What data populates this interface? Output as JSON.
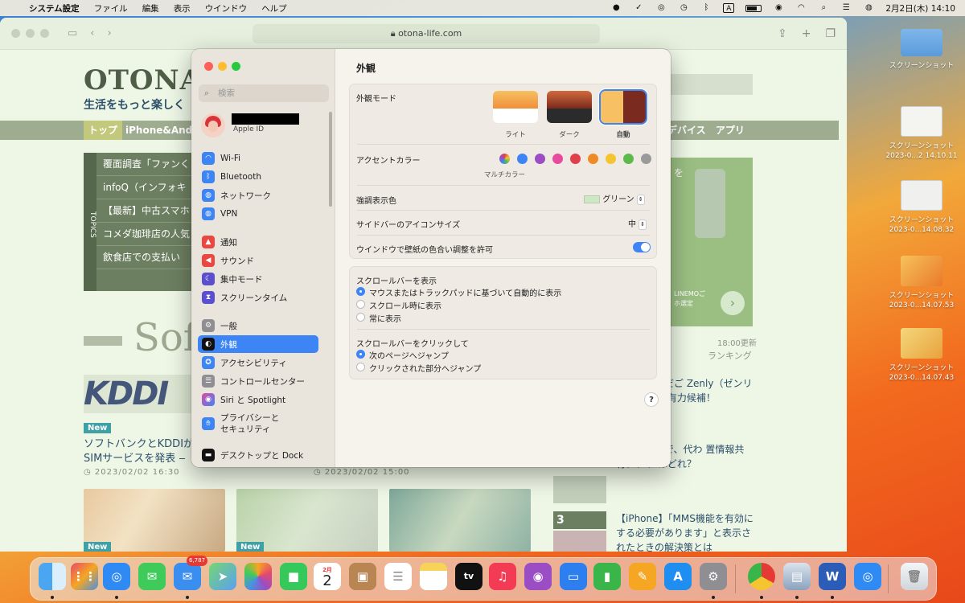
{
  "menubar": {
    "app_name": "システム設定",
    "items": [
      "ファイル",
      "編集",
      "表示",
      "ウインドウ",
      "ヘルプ"
    ],
    "clock": "2月2日(木)  14:10",
    "input_indicator": "A"
  },
  "browser": {
    "url": "otona-life.com"
  },
  "website": {
    "logo": "OTONA L",
    "tagline": "生活をもっと楽しく",
    "nav": [
      "トップ",
      "iPhone&And",
      "デバイス アプリ"
    ],
    "topics_label": "TOPICS",
    "topics": [
      "覆面調査「ファンく",
      "infoQ（インフォキ",
      "【最新】中古スマホ",
      "コメダ珈琲店の人気",
      "飲食店での支払い"
    ],
    "soft_heading": "Sof",
    "kddi_logo": "KDDI",
    "badge_new": "New",
    "article_title": "ソフトバンクとKDDIが SIMサービスを発表 ‒",
    "date1": "2023/02/02 16:30",
    "date2": "2023/02/02 15:00",
    "right_ad_text1": "を",
    "right_ad_text2": "LINEMOご",
    "right_ad_text3": "ホ選定",
    "ranking_updated": "18:00更新",
    "ranking_label": "ランキング",
    "right_article1": "アプリ「友だご Zenly（ゼンリー） プリ最有力候補！",
    "right_article2": "リー）終了で、代わ 置情報共有アプリ はどれ？",
    "right_article3": "【iPhone】「MMS機能を有効に する必要があります」と表示さ れたときの解決策とは",
    "rank_number": "3"
  },
  "prefs": {
    "search_placeholder": "検索",
    "apple_id_label": "Apple ID",
    "sidebar": [
      {
        "label": "Wi-Fi"
      },
      {
        "label": "Bluetooth"
      },
      {
        "label": "ネットワーク"
      },
      {
        "label": "VPN"
      },
      {
        "label": "通知"
      },
      {
        "label": "サウンド"
      },
      {
        "label": "集中モード"
      },
      {
        "label": "スクリーンタイム"
      },
      {
        "label": "一般"
      },
      {
        "label": "外観"
      },
      {
        "label": "アクセシビリティ"
      },
      {
        "label": "コントロールセンター"
      },
      {
        "label": "Siri と Spotlight"
      },
      {
        "label": "プライバシーと セキュリティ"
      },
      {
        "label": "デスクトップと Dock"
      }
    ],
    "title": "外観",
    "appearance_mode_label": "外観モード",
    "modes": [
      "ライト",
      "ダーク",
      "自動"
    ],
    "accent_label": "アクセントカラー",
    "accent_colors": [
      "#3d84f5",
      "#9b4dc4",
      "#e74b9e",
      "#e0404a",
      "#f08a24",
      "#f5c531",
      "#5dba4a",
      "#9a9a9a"
    ],
    "multicolor_label": "マルチカラー",
    "highlight_label": "強調表示色",
    "highlight_value": "グリーン",
    "sidebar_icon_label": "サイドバーのアイコンサイズ",
    "sidebar_icon_value": "中",
    "wallpaper_tint_label": "ウインドウで壁紙の色合い調整を許可",
    "scrollbar_show_label": "スクロールバーを表示",
    "scroll_options": [
      "マウスまたはトラックパッドに基づいて自動的に表示",
      "スクロール時に表示",
      "常に表示"
    ],
    "scrollbar_click_label": "スクロールバーをクリックして",
    "click_options": [
      "次のページへジャンプ",
      "クリックされた部分へジャンプ"
    ],
    "help": "?"
  },
  "desktop": [
    {
      "label": "スクリーンショット"
    },
    {
      "label": "スクリーンショット 2023-0...2 14.10.11"
    },
    {
      "label": "スクリーンショット 2023-0...14.08.32"
    },
    {
      "label": "スクリーンショット 2023-0...14.07.53"
    },
    {
      "label": "スクリーンショット 2023-0...14.07.43"
    }
  ],
  "dock": {
    "mail_badge": "6,787",
    "calendar_month": "2月",
    "calendar_day": "2",
    "tv_label": "tv"
  }
}
